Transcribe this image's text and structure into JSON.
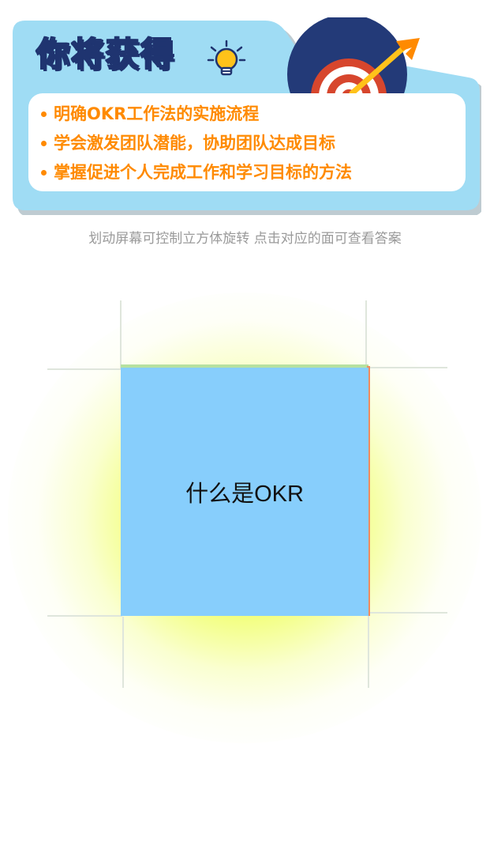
{
  "banner": {
    "title": "你将获得",
    "bullets": [
      "明确OKR工作法的实施流程",
      "学会激发团队潜能，协助团队达成目标",
      "掌握促进个人完成工作和学习目标的方法"
    ],
    "icons": [
      "lightbulb-icon",
      "target-icon"
    ],
    "colors": {
      "banner_bg": "#9fdcf4",
      "title_stroke": "#1f3470",
      "bullet_text": "#ff8a00"
    }
  },
  "hint": "划动屏幕可控制立方体旋转 点击对应的面可查看答案",
  "cube": {
    "front_face_label": "什么是OKR",
    "colors": {
      "front_face": "#87cefc",
      "glow": "#ecff50"
    }
  }
}
